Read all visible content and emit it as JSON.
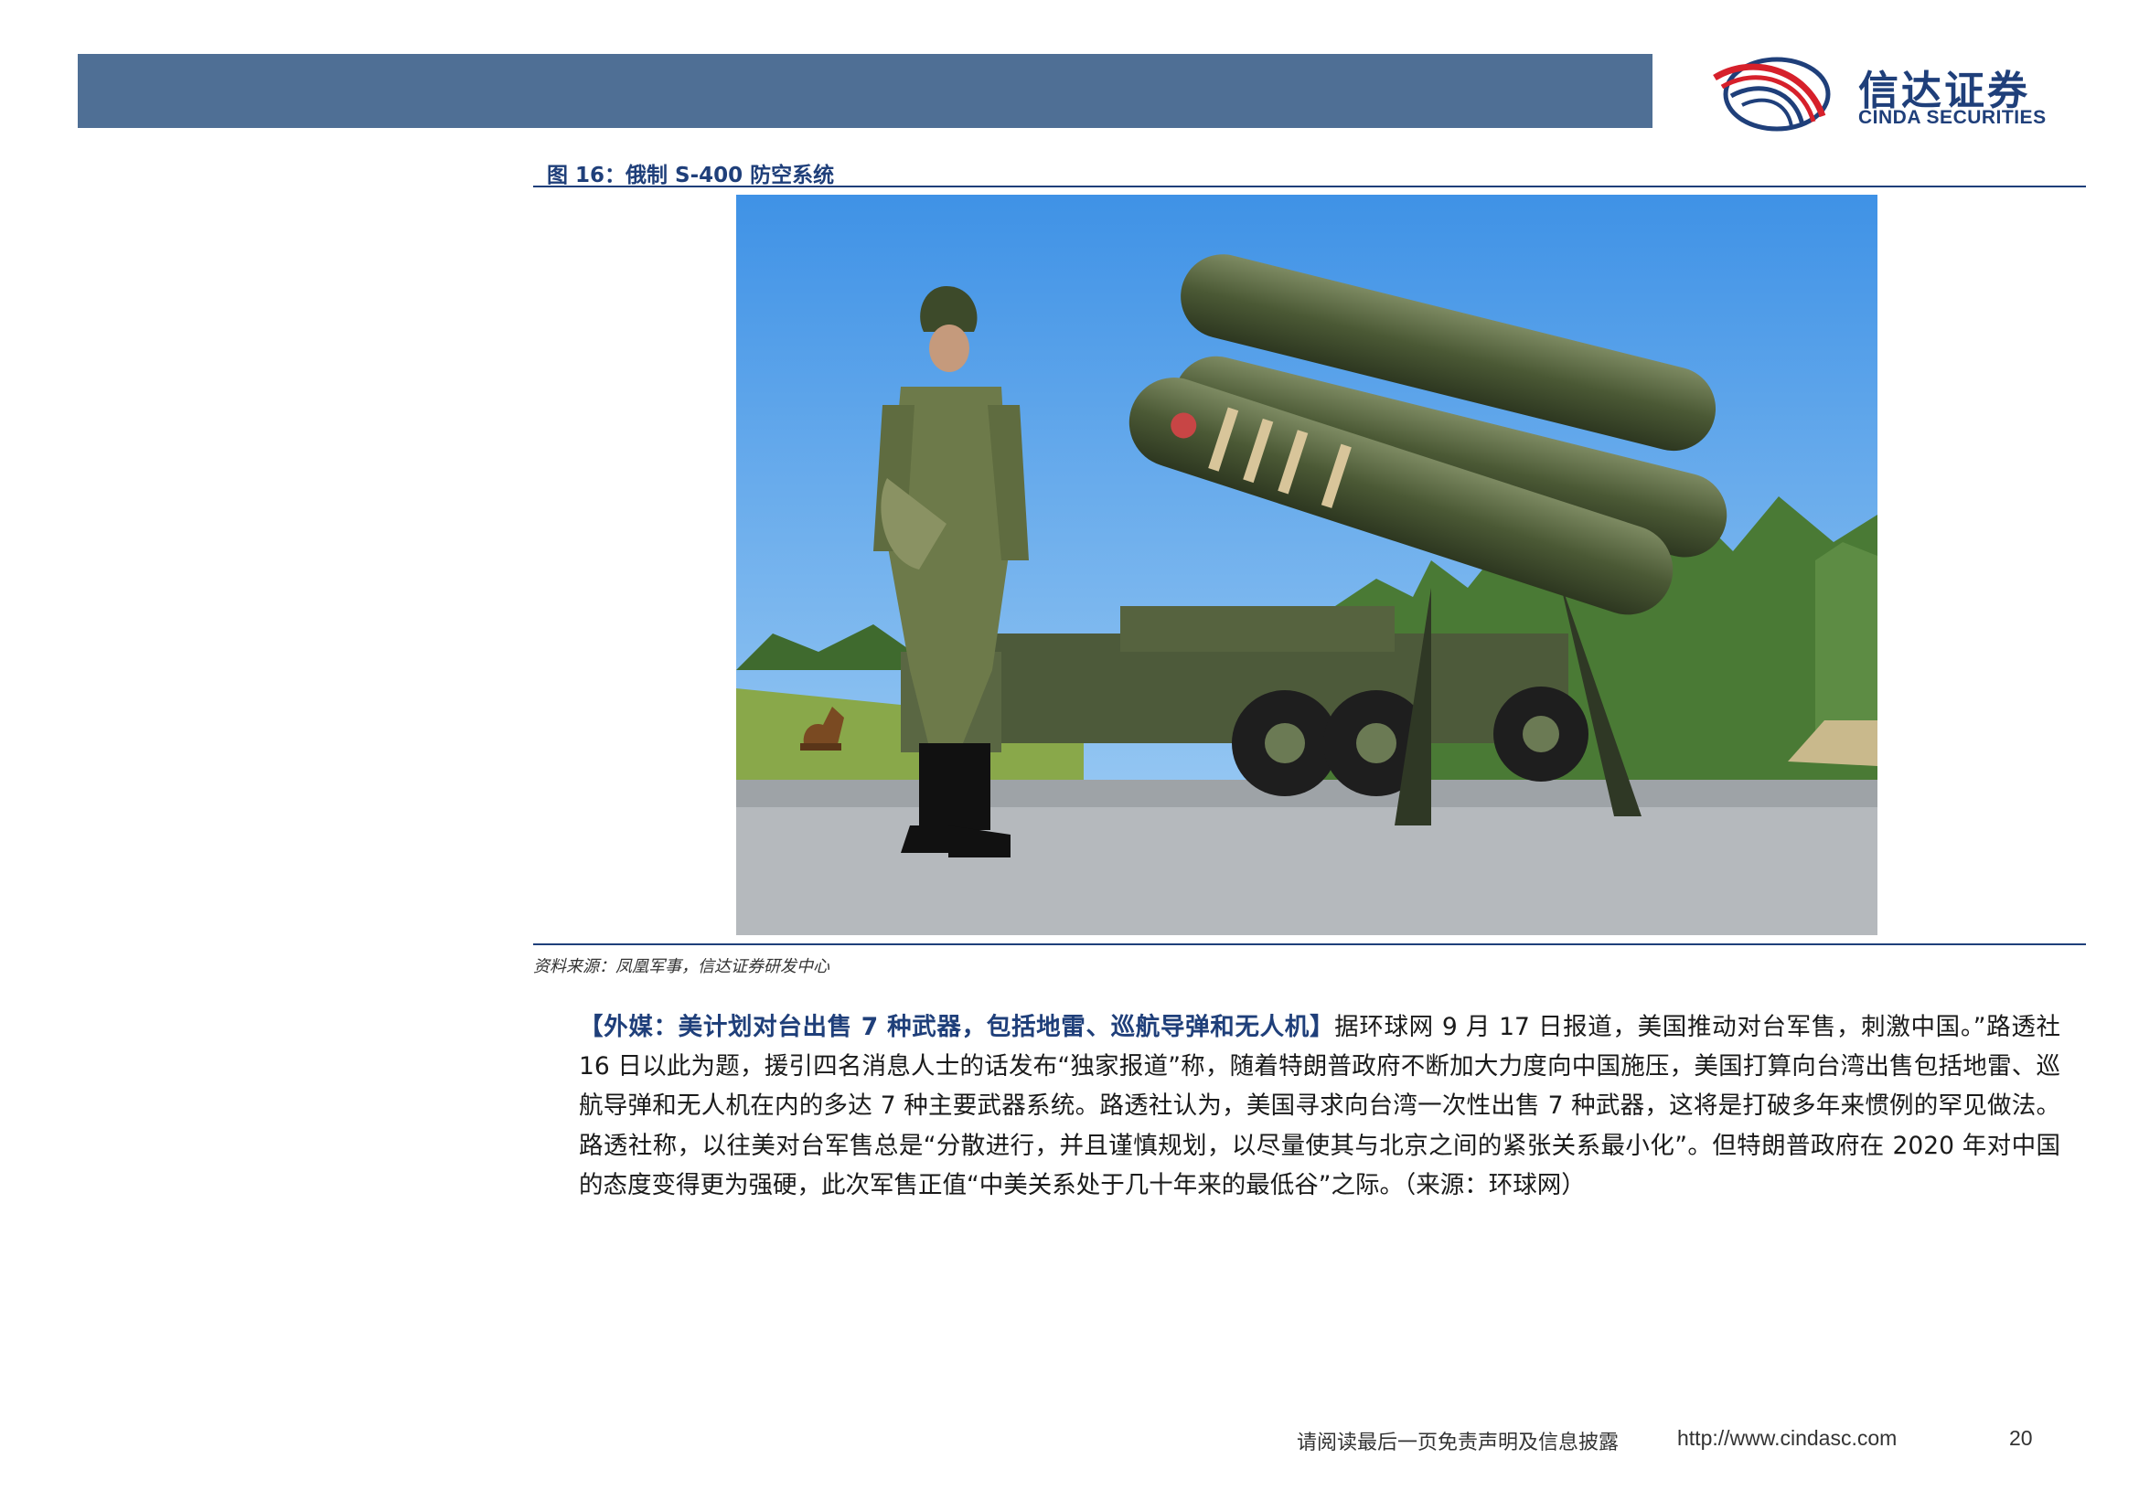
{
  "header": {
    "logo_cn": "信达证券",
    "logo_en": "CINDA SECURITIES"
  },
  "figure": {
    "caption": "图 16：俄制 S-400 防空系统",
    "image_alt": "S-400 launcher vehicle with soldier and dog",
    "source": "资料来源：凤凰军事，信达证券研发中心"
  },
  "article": {
    "lead": "【外媒：美计划对台出售 7 种武器，包括地雷、巡航导弹和无人机】",
    "text": "据环球网 9 月 17 日报道，美国推动对台军售，刺激中国。”路透社 16 日以此为题，援引四名消息人士的话发布“独家报道”称，随着特朗普政府不断加大力度向中国施压，美国打算向台湾出售包括地雷、巡航导弹和无人机在内的多达 7 种主要武器系统。路透社认为，美国寻求向台湾一次性出售 7 种武器，这将是打破多年来惯例的罕见做法。路透社称，以往美对台军售总是“分散进行，并且谨慎规划，以尽量使其与北京之间的紧张关系最小化”。但特朗普政府在 2020 年对中国的态度变得更为强硬，此次军售正值“中美关系处于几十年来的最低谷”之际。（来源：环球网）"
  },
  "footer": {
    "disclaimer": "请阅读最后一页免责声明及信息披露",
    "url": "http://www.cindasc.com",
    "page_number": "20"
  },
  "colors": {
    "header_bar": "#4f6f95",
    "brand_blue": "#1f3f7a",
    "brand_red": "#d6202b"
  }
}
